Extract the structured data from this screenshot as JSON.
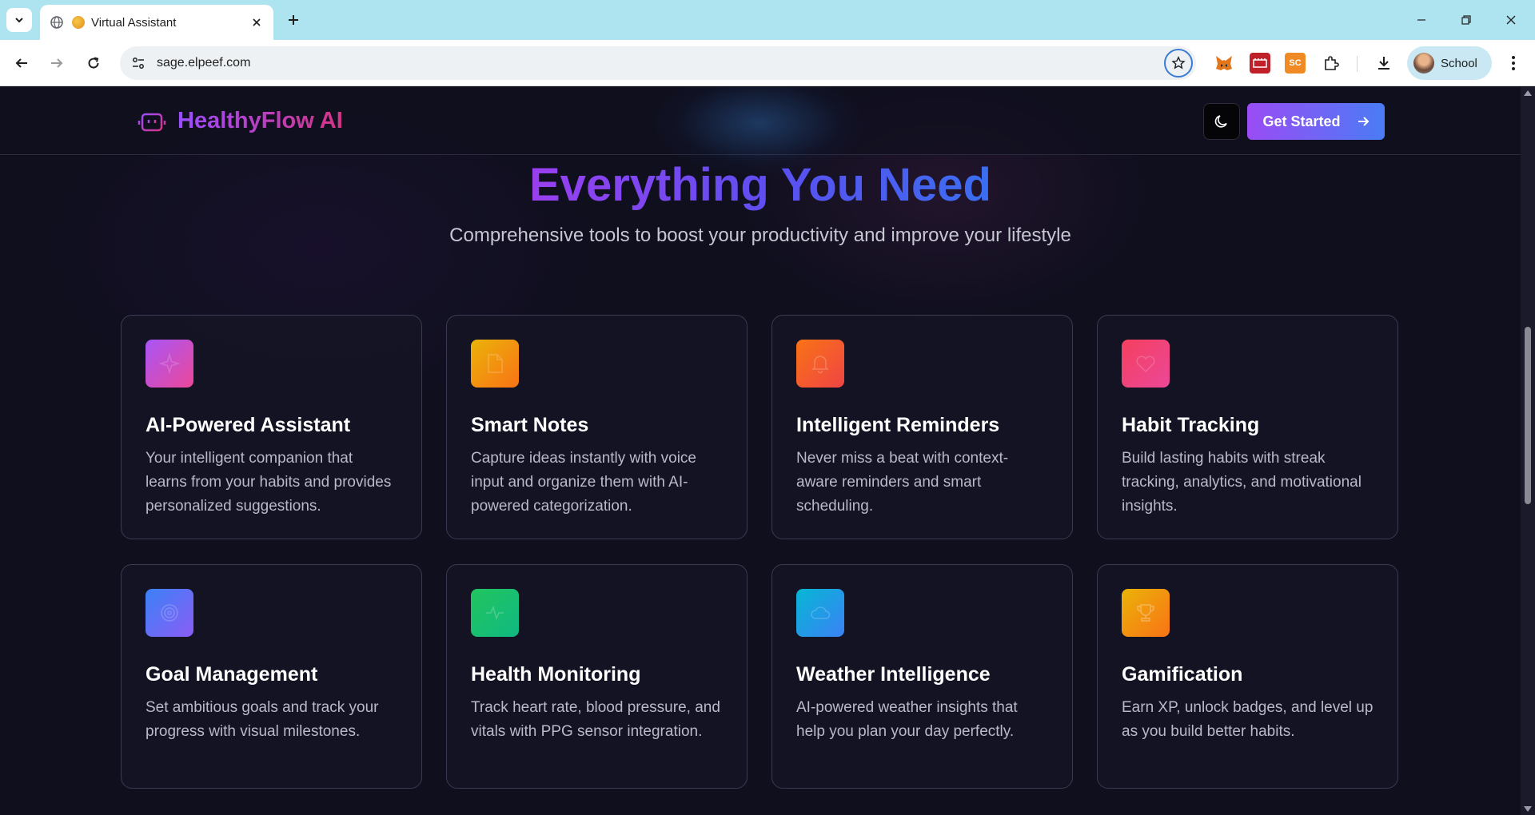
{
  "browser": {
    "tab_title": "Virtual Assistant",
    "url": "sage.elpeef.com",
    "profile_name": "School",
    "extensions": [
      {
        "name": "metamask-fox-icon",
        "label": "",
        "color": "#e2761b"
      },
      {
        "name": "red-extension-icon",
        "label": "",
        "color": "#c0202a"
      },
      {
        "name": "sc-extension-icon",
        "label": "SC",
        "color": "#f08a24"
      }
    ]
  },
  "header": {
    "brand": "HealthyFlow AI",
    "cta_label": "Get Started"
  },
  "hero": {
    "title": "Everything You Need",
    "subtitle": "Comprehensive tools to boost your productivity and improve your lifestyle"
  },
  "features": [
    {
      "title": "AI-Powered Assistant",
      "description": "Your intelligent companion that learns from your habits and provides personalized suggestions.",
      "icon": "sparkles-icon",
      "gradient": [
        "#a855f7",
        "#ec4899"
      ]
    },
    {
      "title": "Smart Notes",
      "description": "Capture ideas instantly with voice input and organize them with AI-powered categorization.",
      "icon": "note-icon",
      "gradient": [
        "#eab308",
        "#f97316"
      ]
    },
    {
      "title": "Intelligent Reminders",
      "description": "Never miss a beat with context-aware reminders and smart scheduling.",
      "icon": "bell-icon",
      "gradient": [
        "#f97316",
        "#ef4444"
      ]
    },
    {
      "title": "Habit Tracking",
      "description": "Build lasting habits with streak tracking, analytics, and motivational insights.",
      "icon": "heart-icon",
      "gradient": [
        "#f43f5e",
        "#ec4899"
      ]
    },
    {
      "title": "Goal Management",
      "description": "Set ambitious goals and track your progress with visual milestones.",
      "icon": "target-icon",
      "gradient": [
        "#3b82f6",
        "#8b5cf6"
      ]
    },
    {
      "title": "Health Monitoring",
      "description": "Track heart rate, blood pressure, and vitals with PPG sensor integration.",
      "icon": "activity-icon",
      "gradient": [
        "#22c55e",
        "#10b981"
      ]
    },
    {
      "title": "Weather Intelligence",
      "description": "AI-powered weather insights that help you plan your day perfectly.",
      "icon": "cloud-icon",
      "gradient": [
        "#06b6d4",
        "#3b82f6"
      ]
    },
    {
      "title": "Gamification",
      "description": "Earn XP, unlock badges, and level up as you build better habits.",
      "icon": "trophy-icon",
      "gradient": [
        "#eab308",
        "#f97316"
      ]
    }
  ]
}
